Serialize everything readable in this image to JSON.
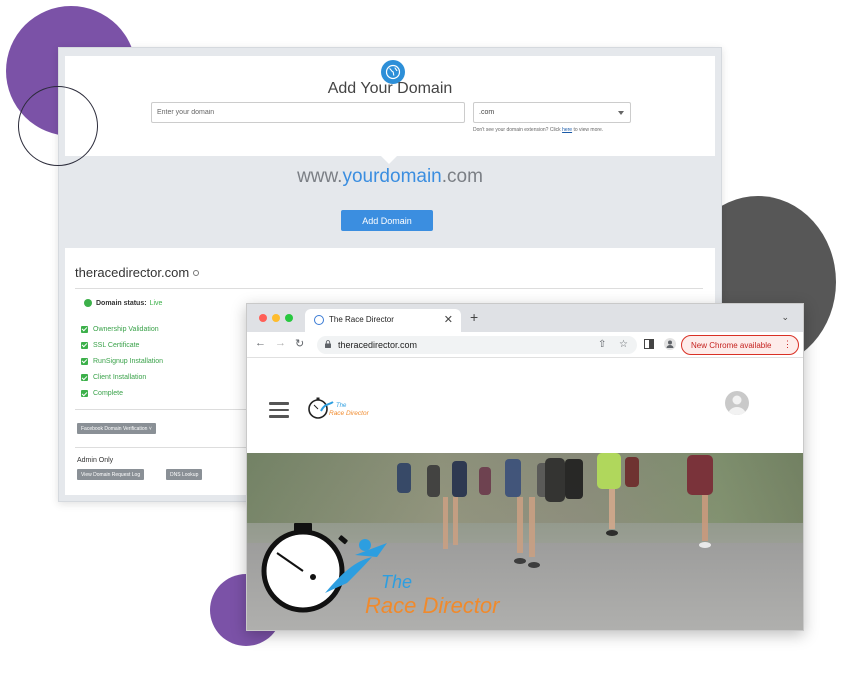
{
  "domain_form": {
    "title": "Add Your Domain",
    "domain_placeholder": "Enter your domain",
    "extension_value": ".com",
    "hint_prefix": "Don't see your domain extension? Click",
    "hint_link": "here",
    "hint_suffix": "to view more.",
    "preview_prefix": "www.",
    "preview_highlight": "yourdomain",
    "preview_suffix": ".com",
    "add_button_label": "Add Domain"
  },
  "domain_status": {
    "domain_name": "theracedirector.com",
    "status_label": "Domain status:",
    "status_value": "Live",
    "checks": [
      "Ownership Validation",
      "SSL Certificate",
      "RunSignup Installation",
      "Client Installation",
      "Complete"
    ],
    "facebook_button_label": "Facebook Domain Verification ˅",
    "admin_label": "Admin Only",
    "admin_buttons": [
      "View Domain Request Log",
      "DNS Lookup"
    ]
  },
  "browser": {
    "tab_title": "The Race Director",
    "tab_close": "✕",
    "new_tab": "+",
    "tab_menu": "⌄",
    "url": "theracedirector.com",
    "chrome_notice": "New Chrome available",
    "chrome_notice_menu": "⋮"
  },
  "site": {
    "logo_line1": "The",
    "logo_line2": "Race Director"
  },
  "colors": {
    "accent_blue": "#3b8ee0",
    "status_green": "#3cb04a",
    "brand_orange": "#f08a2c",
    "brand_blue": "#2d9ee0",
    "deco_purple": "#7b52a7",
    "deco_gray": "#575757"
  }
}
